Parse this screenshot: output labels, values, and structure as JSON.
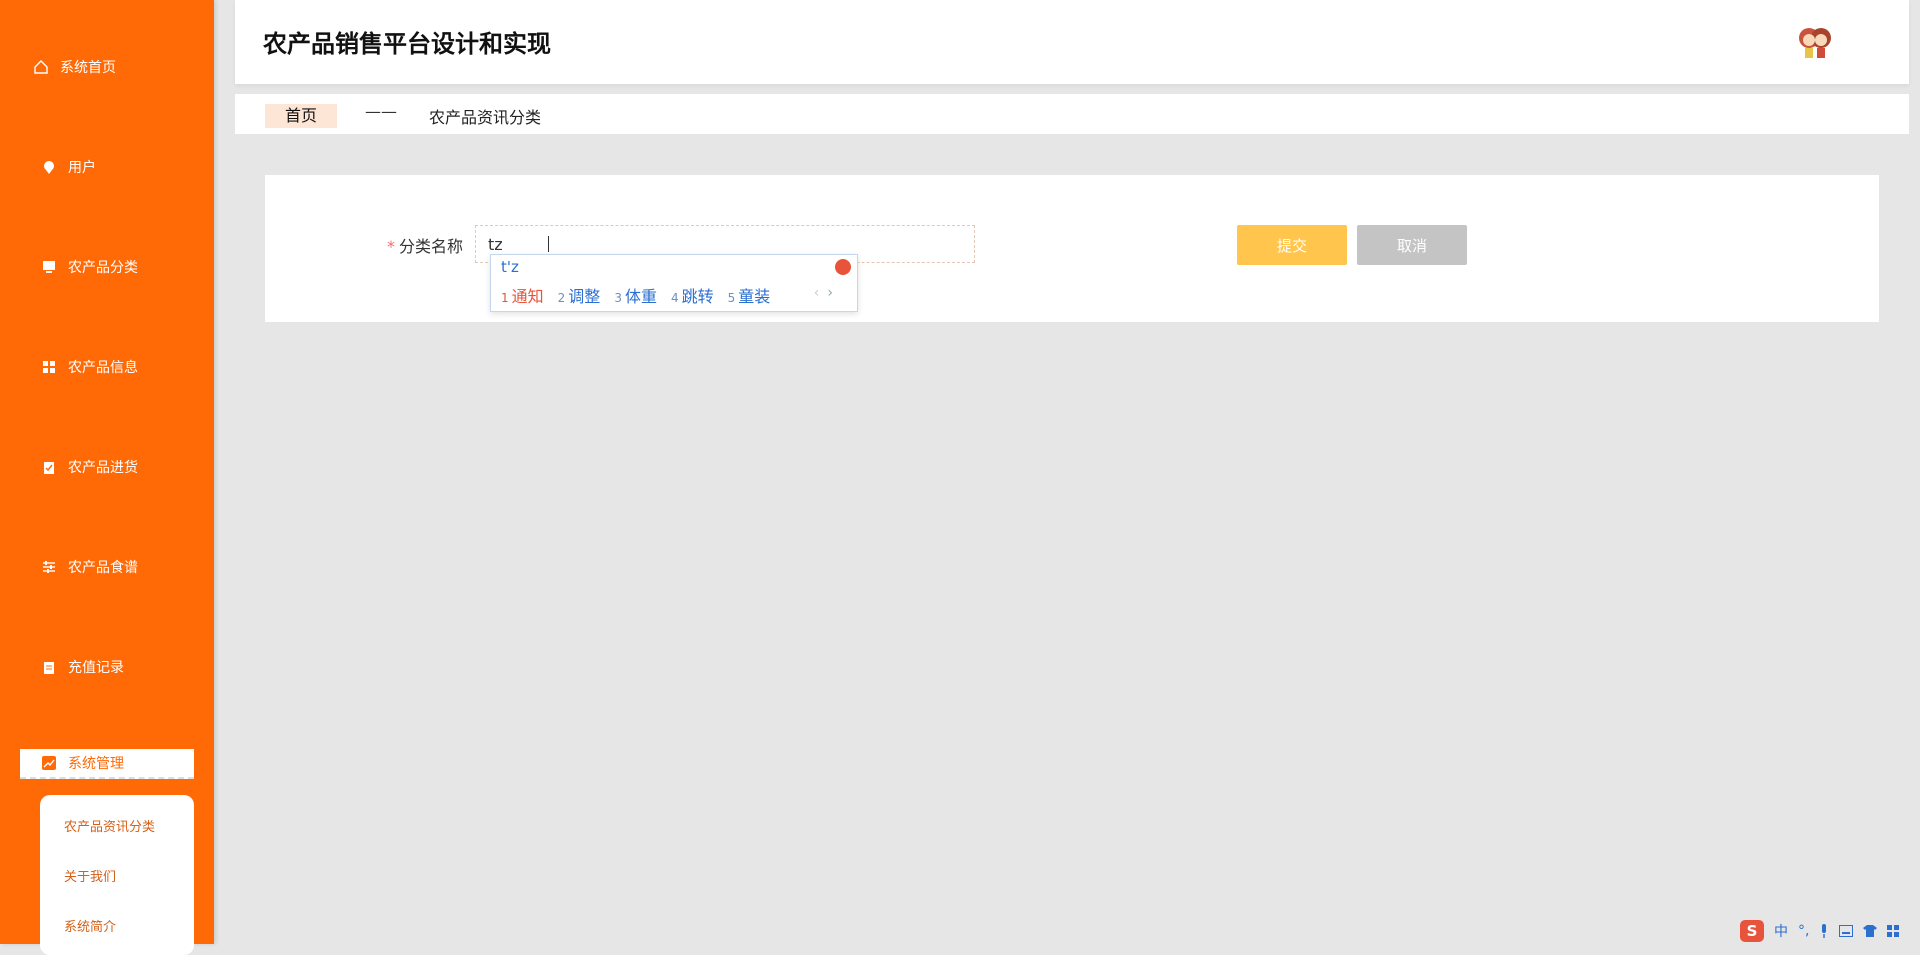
{
  "app": {
    "title": "农产品销售平台设计和实现"
  },
  "sidebar": {
    "items": [
      {
        "label": "系统首页",
        "icon": "home-icon"
      },
      {
        "label": "用户",
        "icon": "location-pin-icon"
      },
      {
        "label": "农产品分类",
        "icon": "monitor-icon"
      },
      {
        "label": "农产品信息",
        "icon": "grid-icon"
      },
      {
        "label": "农产品进货",
        "icon": "clipboard-check-icon"
      },
      {
        "label": "农产品食谱",
        "icon": "sliders-icon"
      },
      {
        "label": "充值记录",
        "icon": "document-icon"
      }
    ],
    "active": {
      "label": "系统管理",
      "icon": "chart-icon"
    },
    "submenu": [
      {
        "label": "农产品资讯分类"
      },
      {
        "label": "关于我们"
      },
      {
        "label": "系统简介"
      }
    ],
    "accent": "#ff6a07"
  },
  "breadcrumb": {
    "home": "首页",
    "separator": "——",
    "current": "农产品资讯分类"
  },
  "form": {
    "required_mark": "*",
    "label": "分类名称",
    "value": "tz",
    "submit_label": "提交",
    "cancel_label": "取消"
  },
  "ime": {
    "composition": "t'z",
    "candidates": [
      {
        "num": "1",
        "text": "通知"
      },
      {
        "num": "2",
        "text": "调整"
      },
      {
        "num": "3",
        "text": "体重"
      },
      {
        "num": "4",
        "text": "跳转"
      },
      {
        "num": "5",
        "text": "童装"
      }
    ],
    "prev": "‹",
    "next": "›"
  },
  "tray": {
    "logo": "S",
    "lang": "中",
    "punct": "°,"
  }
}
